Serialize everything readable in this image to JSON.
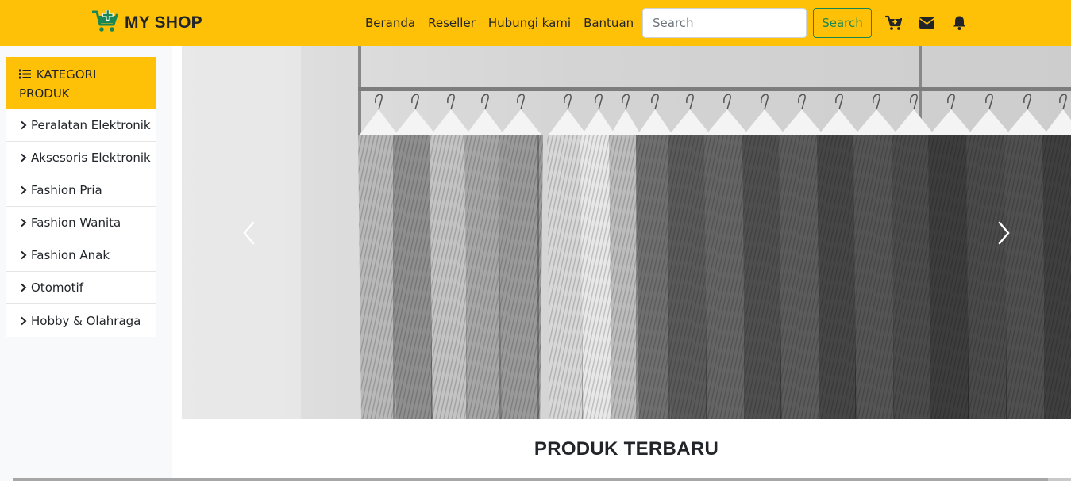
{
  "navbar": {
    "brand": "MY SHOP",
    "links": [
      "Beranda",
      "Reseller",
      "Hubungi kami",
      "Bantuan"
    ],
    "search_placeholder": "Search",
    "search_button": "Search",
    "icons": [
      "cart-plus-icon",
      "envelope-icon",
      "bell-icon"
    ],
    "bg_color": "#ffc107",
    "brand_icon_color": "#198754"
  },
  "sidebar": {
    "header": "KATEGORI PRODUK",
    "header_icon": "list-icon",
    "items": [
      {
        "label": "Peralatan Elektronik"
      },
      {
        "label": "Aksesoris Elektronik"
      },
      {
        "label": "Fashion Pria"
      },
      {
        "label": "Fashion Wanita"
      },
      {
        "label": "Fashion Anak"
      },
      {
        "label": "Otomotif"
      },
      {
        "label": "Hobby & Olahraga"
      }
    ]
  },
  "carousel": {
    "prev_icon": "chevron-left-icon",
    "next_icon": "chevron-right-icon"
  },
  "section": {
    "title": "PRODUK TERBARU"
  }
}
